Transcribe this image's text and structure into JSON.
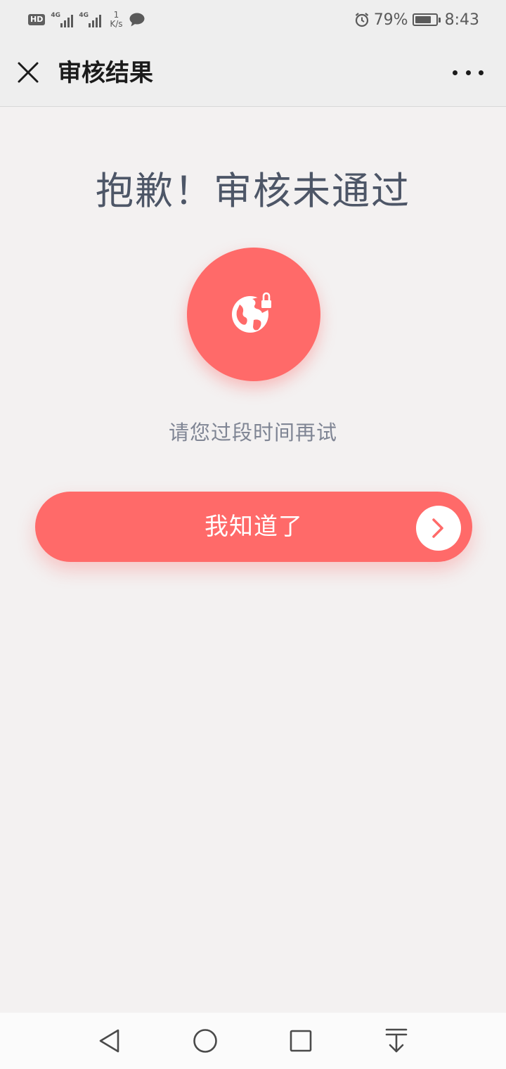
{
  "status_bar": {
    "hd_badge": "HD",
    "net_type_1": "4G",
    "net_type_2": "4G",
    "speed_value": "1",
    "speed_unit": "K/s",
    "battery_percent": "79%",
    "battery_level": 0.79,
    "time": "8:43"
  },
  "header": {
    "title": "审核结果"
  },
  "main": {
    "heading": "抱歉！审核未通过",
    "subtitle": "请您过段时间再试",
    "confirm_button_label": "我知道了",
    "icon": "globe-lock-icon"
  },
  "bottom_nav": {
    "back_icon": "back-triangle-icon",
    "home_icon": "home-circle-icon",
    "recents_icon": "recents-square-icon",
    "notification_icon": "pull-down-icon"
  },
  "colors": {
    "accent": "#ff6a69",
    "heading_text": "#4d5667",
    "subtitle_text": "#7f8594",
    "page_background": "#f3f1f1",
    "header_background": "#eeeeee"
  }
}
